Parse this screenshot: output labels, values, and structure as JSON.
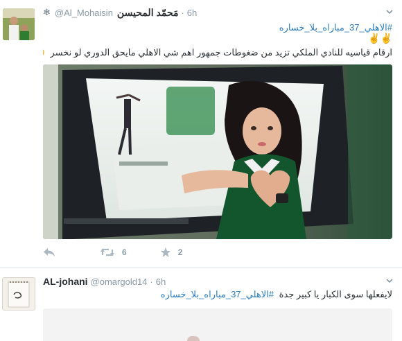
{
  "tweets": [
    {
      "name": "مَحمّد المحيسن",
      "handle": "@Al_Mohaisin",
      "time": "6h",
      "hashtag": "#الاهلي_37_مباراه_بلا_خساره",
      "hashtag_emoji": "✌✌",
      "text": "ارقام قياسيه للنادي الملكي تزيد من ضغوطات جمهور اهم شي الاهلي مايحق الدوري لو نخسر",
      "text_emoji": "😛",
      "retweets": "6",
      "favorites": "2"
    },
    {
      "name": "AL-johani",
      "handle": "@omargold14",
      "time": "6h",
      "text": "لايفعلها سوى الكبار يا كبير جدة",
      "hashtag": "#الاهلي_37_مباراه_بلا_خساره"
    }
  ],
  "icons": {
    "verified_glyph": "snowflake-icon",
    "caret": "chevron-down-icon",
    "reply": "reply-icon",
    "retweet": "retweet-icon",
    "favorite": "star-icon"
  },
  "colors": {
    "link": "#2b7bb9",
    "muted": "#8899a6",
    "text": "#292f33",
    "divider": "#e1e8ed"
  }
}
